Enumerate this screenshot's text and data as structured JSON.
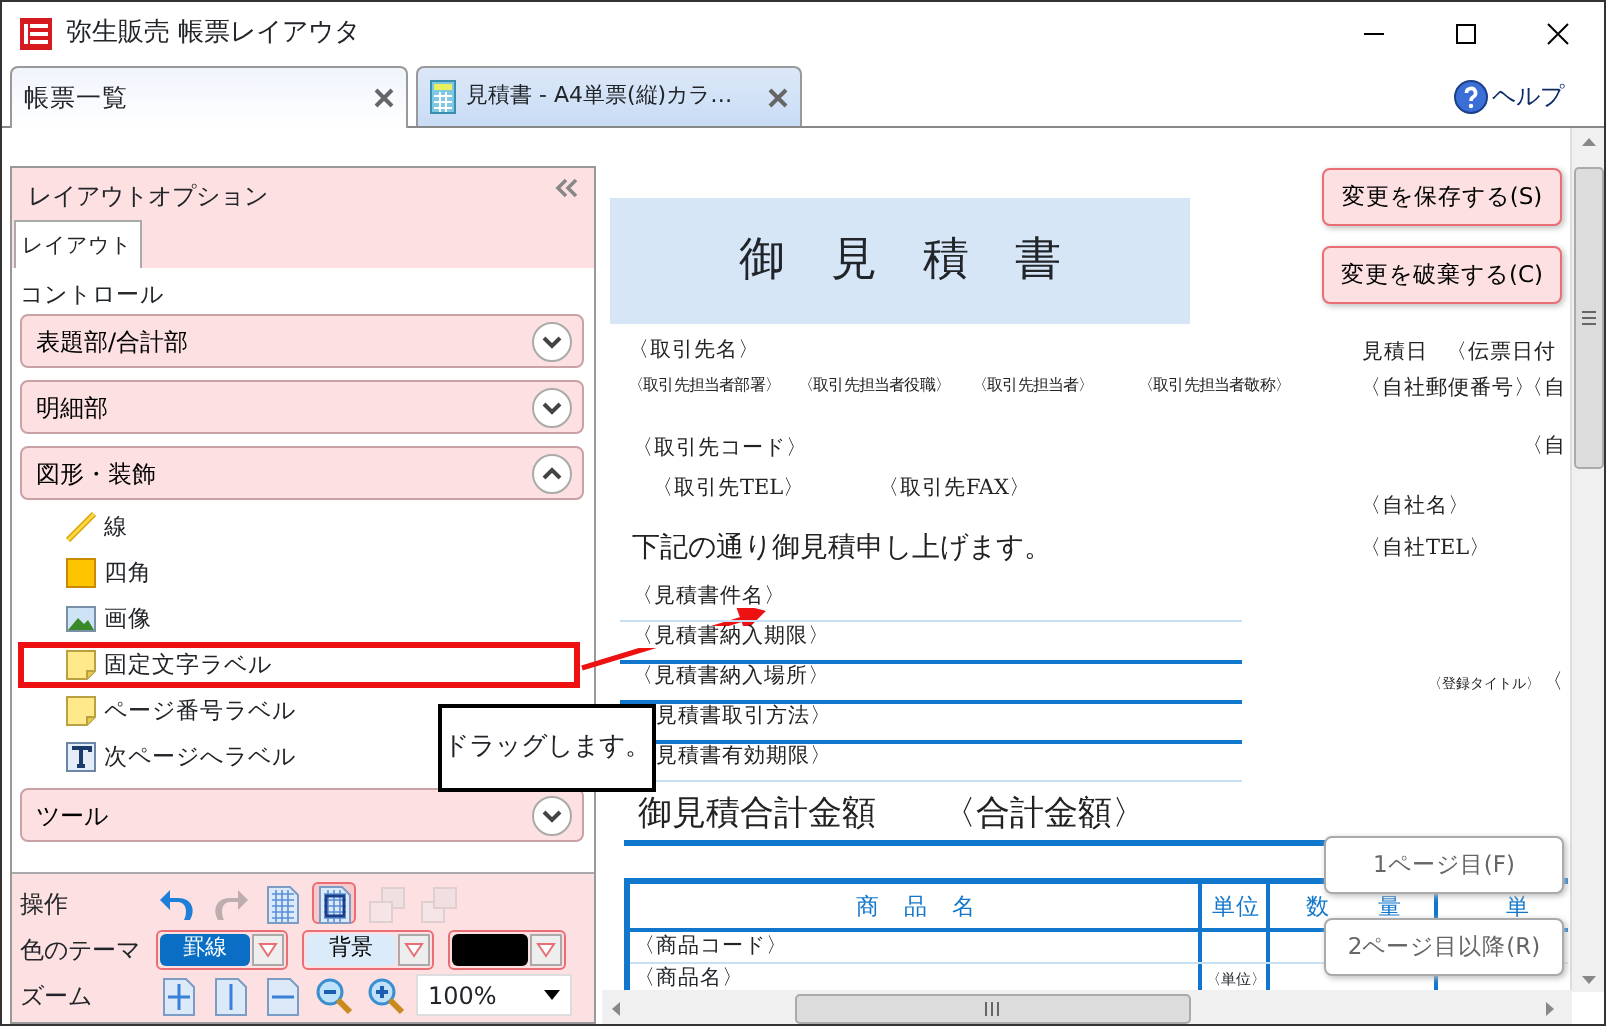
{
  "window": {
    "title": "弥生販売 帳票レイアウタ"
  },
  "tabs": [
    {
      "label": "帳票一覧",
      "selected": true,
      "kind": "list"
    },
    {
      "label": "見積書 - A4単票(縦)カラ…",
      "selected": false,
      "kind": "document"
    }
  ],
  "help": {
    "label": "ヘルプ"
  },
  "options_panel": {
    "title": "レイアウトオプション",
    "tabs": [
      {
        "label": "レイアウト",
        "selected": true
      }
    ],
    "section_label": "コントロール",
    "groups": [
      {
        "label": "表題部/合計部",
        "expanded": false
      },
      {
        "label": "明細部",
        "expanded": false
      },
      {
        "label": "図形・装飾",
        "expanded": true,
        "items": [
          {
            "label": "線",
            "kind": "line",
            "marked": false
          },
          {
            "label": "四角",
            "kind": "rect",
            "marked": false
          },
          {
            "label": "画像",
            "kind": "image",
            "marked": false
          },
          {
            "label": "固定文字ラベル",
            "kind": "note",
            "marked": true
          },
          {
            "label": "ページ番号ラベル",
            "kind": "note",
            "marked": false
          },
          {
            "label": "次ページへラベル",
            "kind": "text",
            "marked": false
          }
        ]
      },
      {
        "label": "ツール",
        "expanded": false
      }
    ]
  },
  "toolbar": {
    "operations_label": "操作",
    "operations": [
      {
        "kind": "undo",
        "disabled": false,
        "selected": false
      },
      {
        "kind": "redo",
        "disabled": true,
        "selected": false
      },
      {
        "kind": "grid",
        "disabled": false,
        "selected": false
      },
      {
        "kind": "snap",
        "disabled": false,
        "selected": true
      },
      {
        "kind": "front",
        "disabled": true,
        "selected": false
      },
      {
        "kind": "back",
        "disabled": true,
        "selected": false
      }
    ],
    "theme_label": "色のテーマ",
    "themes": [
      {
        "kind": "text",
        "label": "罫線",
        "selected": true
      },
      {
        "kind": "text",
        "label": "背景",
        "selected": false
      },
      {
        "kind": "swatch",
        "color": "#000000"
      }
    ],
    "zoom_label": "ズーム",
    "zoom_tools": [
      {
        "kind": "fit-page"
      },
      {
        "kind": "fit-height"
      },
      {
        "kind": "fit-width"
      },
      {
        "kind": "zoom-out"
      },
      {
        "kind": "zoom-in"
      }
    ],
    "zoom_value": "100%"
  },
  "document": {
    "title": "御　見　積　書",
    "fields": [
      {
        "text": "〈取引先名〉",
        "kind": "normal"
      },
      {
        "text": "〈取引先担当者部署〉",
        "kind": "small"
      },
      {
        "text": "〈取引先担当者役職〉",
        "kind": "small"
      },
      {
        "text": "〈取引先担当者〉",
        "kind": "small"
      },
      {
        "text": "〈取引先担当者敬称〉",
        "kind": "small"
      },
      {
        "text": "〈取引先コード〉",
        "kind": "normal"
      },
      {
        "text": "〈取引先TEL〉",
        "kind": "normal"
      },
      {
        "text": "〈取引先FAX〉",
        "kind": "normal"
      },
      {
        "text": "下記の通り御見積申し上げます。",
        "kind": "large"
      },
      {
        "text": "〈見積書件名〉",
        "kind": "normal"
      },
      {
        "text": "〈見積書納入期限〉",
        "kind": "normal"
      },
      {
        "text": "〈見積書納入場所〉",
        "kind": "normal"
      },
      {
        "text": "見積書取引方法〉",
        "kind": "normal"
      },
      {
        "text": "見積書有効期限〉",
        "kind": "normal"
      },
      {
        "text": "御見積合計金額",
        "kind": "total"
      },
      {
        "text": "〈合計金額〉",
        "kind": "total"
      },
      {
        "text": "見積日",
        "kind": "normal"
      },
      {
        "text": "〈伝票日付",
        "kind": "normal"
      },
      {
        "text": "〈自社郵便番号〉",
        "kind": "normal"
      },
      {
        "text": "〈自",
        "kind": "normal"
      },
      {
        "text": "〈自",
        "kind": "normal"
      },
      {
        "text": "〈自社名〉",
        "kind": "normal"
      },
      {
        "text": "〈自社TEL〉",
        "kind": "normal"
      },
      {
        "text": "〈登録タイトル〉",
        "kind": "tiny"
      },
      {
        "text": "〈",
        "kind": "normal"
      }
    ],
    "table": {
      "columns": [
        "商　品　名",
        "単位",
        "数　　量",
        "単"
      ],
      "rows": [
        [
          "〈商品コード〉",
          "",
          ""
        ],
        [
          "〈商品名〉",
          "〈単位〉",
          ""
        ]
      ]
    }
  },
  "actions": [
    {
      "label": "変更を保存する(S)",
      "kind": "top"
    },
    {
      "label": "変更を破棄する(C)",
      "kind": "top"
    },
    {
      "label": "1ページ目(F)",
      "kind": "page"
    },
    {
      "label": "2ページ目以降(R)",
      "kind": "page"
    }
  ],
  "callout": {
    "text": "ドラッグします。"
  }
}
